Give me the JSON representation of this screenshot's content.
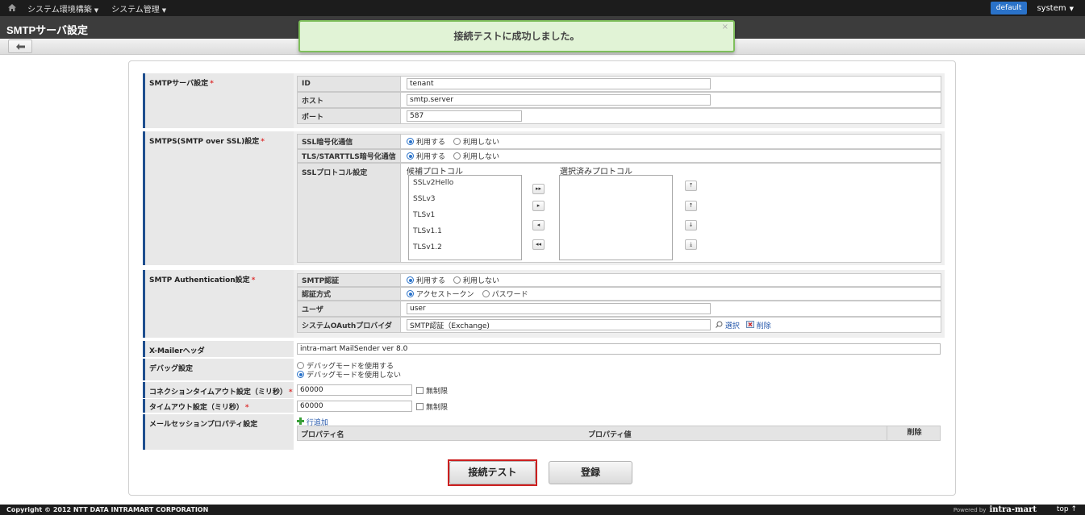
{
  "topbar": {
    "menus": [
      {
        "label": "システム環境構築",
        "caret": "▼"
      },
      {
        "label": "システム管理",
        "caret": "▼"
      }
    ],
    "badge": "default",
    "user": "system",
    "user_caret": "▼"
  },
  "page": {
    "title": "SMTPサーバ設定"
  },
  "toast": {
    "message": "接続テストに成功しました。",
    "close": "×"
  },
  "smtp_server": {
    "label": "SMTPサーバ設定",
    "required": "*",
    "rows": [
      {
        "label": "ID",
        "value": "tenant"
      },
      {
        "label": "ホスト",
        "value": "smtp.server"
      },
      {
        "label": "ポート",
        "value": "587"
      }
    ]
  },
  "smtps": {
    "label": "SMTPS(SMTP over SSL)設定",
    "required": "*",
    "ssl_label": "SSL暗号化通信",
    "tls_label": "TLS/STARTTLS暗号化通信",
    "use": "利用する",
    "not_use": "利用しない",
    "protocol_label": "SSLプロトコル設定",
    "candidate_title": "候補プロトコル",
    "selected_title": "選択済みプロトコル",
    "candidates": [
      "SSLv2Hello",
      "SSLv3",
      "TLSv1",
      "TLSv1.1",
      "TLSv1.2"
    ],
    "move_buttons": [
      "▸▸",
      "▸",
      "◂",
      "◂◂"
    ],
    "order_buttons": [
      "⤒",
      "↑",
      "↓",
      "⤓"
    ]
  },
  "smtp_auth": {
    "label": "SMTP Authentication設定",
    "required": "*",
    "auth_label": "SMTP認証",
    "use": "利用する",
    "not_use": "利用しない",
    "method_label": "認証方式",
    "method_token": "アクセストークン",
    "method_password": "パスワード",
    "user_label": "ユーザ",
    "user_value": "user",
    "provider_label": "システムOAuthプロバイダ",
    "provider_value": "SMTP認証（Exchange)",
    "select_link": "選択",
    "delete_link": "削除"
  },
  "xmailer": {
    "label": "X-Mailerヘッダ",
    "value": "intra-mart MailSender ver 8.0"
  },
  "debug": {
    "label": "デバッグ設定",
    "opt_on": "デバッグモードを使用する",
    "opt_off": "デバッグモードを使用しない"
  },
  "conn_timeout": {
    "label": "コネクションタイムアウト設定（ミリ秒）",
    "required": "*",
    "value": "60000",
    "unlimited": "無制限"
  },
  "timeout": {
    "label": "タイムアウト設定（ミリ秒）",
    "required": "*",
    "value": "60000",
    "unlimited": "無制限"
  },
  "mail_session": {
    "label": "メールセッションプロパティ設定",
    "add_row": "行追加",
    "col_name": "プロパティ名",
    "col_value": "プロパティ値",
    "col_delete": "削除"
  },
  "actions": {
    "test": "接続テスト",
    "register": "登録"
  },
  "footer": {
    "copyright": "Copyright © 2012 NTT DATA INTRAMART CORPORATION",
    "powered": "Powered by",
    "brand": "intra-mart",
    "top": "top ↑"
  },
  "colors": {
    "accent": "#2a72c9",
    "toast_bg": "#e1f3d6",
    "toast_border": "#7fbf5c",
    "highlight": "#cc1f1f"
  }
}
